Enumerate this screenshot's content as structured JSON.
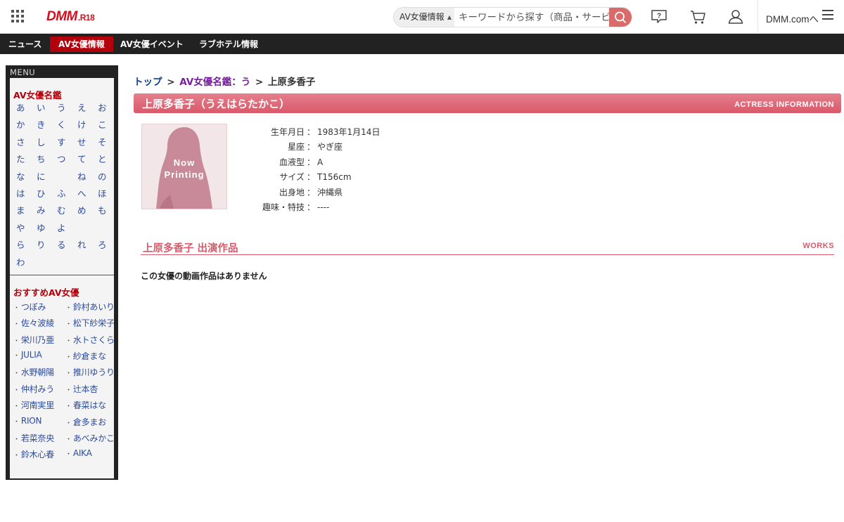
{
  "header": {
    "logo_main": "DMM",
    "logo_sub": ".R18",
    "search": {
      "category": "AV女優情報",
      "placeholder": "キーワードから探す（商品・サービス）"
    },
    "dmm_link": "DMM.comへ"
  },
  "nav": {
    "items": [
      {
        "label": "ニュース",
        "active": false
      },
      {
        "label": "AV女優情報",
        "active": true
      },
      {
        "label": "AV女優イベント",
        "active": false
      },
      {
        "label": "ラブホテル情報",
        "active": false
      }
    ]
  },
  "sidebar": {
    "menu_title": "MENU",
    "directory_title": "AV女優名鑑",
    "kana": [
      "あ",
      "い",
      "う",
      "え",
      "お",
      "か",
      "き",
      "く",
      "け",
      "こ",
      "さ",
      "し",
      "す",
      "せ",
      "そ",
      "た",
      "ち",
      "つ",
      "て",
      "と",
      "な",
      "に",
      "",
      "ね",
      "の",
      "は",
      "ひ",
      "ふ",
      "へ",
      "ほ",
      "ま",
      "み",
      "む",
      "め",
      "も",
      "や",
      "ゆ",
      "よ",
      "",
      "",
      "ら",
      "り",
      "る",
      "れ",
      "ろ",
      "わ"
    ],
    "recommended_title": "おすすめAV女優",
    "recommended": [
      "つぼみ",
      "鈴村あいり",
      "佐々波綾",
      "松下紗栄子",
      "栄川乃亜",
      "水トさくら",
      "JULIA",
      "紗倉まな",
      "水野朝陽",
      "推川ゆうり",
      "仲村みう",
      "辻本杏",
      "河南実里",
      "春菜はな",
      "RION",
      "倉多まお",
      "若菜奈央",
      "あべみかこ",
      "鈴木心春",
      "AIKA"
    ]
  },
  "breadcrumb": {
    "top": "トップ",
    "directory": "AV女優名鑑：う",
    "current": "上原多香子",
    "separator": ">"
  },
  "actress": {
    "title": "上原多香子（うえはらたかこ）",
    "section_en": "ACTRESS INFORMATION",
    "photo_text_line1": "Now",
    "photo_text_line2": "Printing",
    "info": [
      {
        "label": "生年月日",
        "value": "1983年1月14日"
      },
      {
        "label": "星座",
        "value": "やぎ座"
      },
      {
        "label": "血液型",
        "value": "A"
      },
      {
        "label": "サイズ",
        "value": "T156cm"
      },
      {
        "label": "出身地",
        "value": "沖縄県"
      },
      {
        "label": "趣味・特技",
        "value": "----"
      }
    ]
  },
  "works": {
    "title": "上原多香子 出演作品",
    "title_en": "WORKS",
    "empty_message": "この女優の動画作品はありません"
  },
  "colors": {
    "brand_red": "#d40e1c",
    "nav_active": "#b3000a",
    "pink": "#d9596a",
    "link_blue": "#2a4aa0"
  }
}
